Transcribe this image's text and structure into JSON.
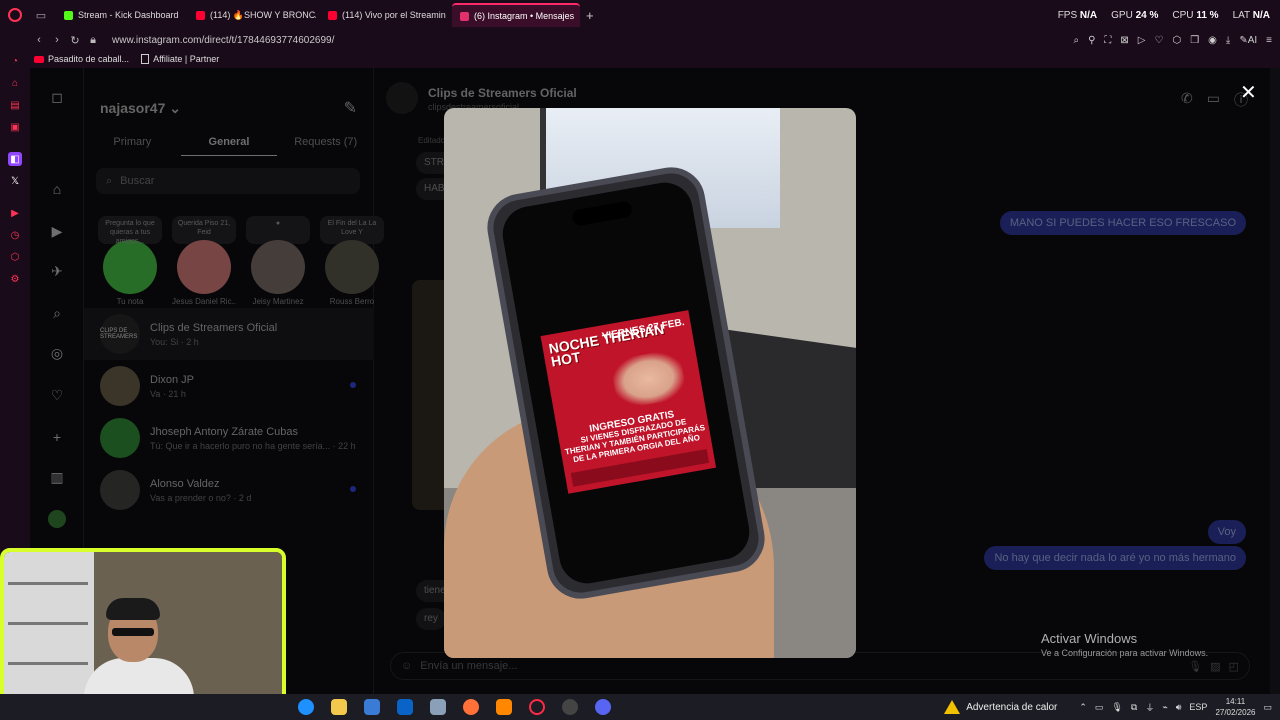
{
  "browser": {
    "tabs": [
      {
        "label": "Stream - Kick Dashboard",
        "color": "#53fc18"
      },
      {
        "label": "(114) 🔥SHOW Y BRONCA",
        "color": "#ff0033"
      },
      {
        "label": "(114) Vivo por el Streamin",
        "color": "#ff0033"
      },
      {
        "label": "(6) Instagram • Mensajes",
        "color": "#e1306c"
      }
    ],
    "url": "www.instagram.com/direct/t/17844693774602699/",
    "bookmarks": [
      "Pasadito de caball...",
      "Affiliate | Partner"
    ],
    "hud": {
      "fps_label": "FPS",
      "fps": "N/A",
      "gpu_label": "GPU",
      "gpu": "24 %",
      "cpu_label": "CPU",
      "cpu": "11 %",
      "lat_label": "LAT",
      "lat": "N/A"
    },
    "ai_label": "AI"
  },
  "instagram": {
    "username": "najasor47",
    "tabs": {
      "primary": "Primary",
      "general": "General",
      "requests": "Requests (7)"
    },
    "search_placeholder": "Buscar",
    "notes": [
      {
        "bubble": "Pregunta lo que quieras a tus amigos...",
        "name": "Tu nota"
      },
      {
        "bubble": "Querida Piso 21, Feid",
        "name": "Jesus Daniel Ric..."
      },
      {
        "bubble": "",
        "name": "Jeisy Martinez"
      },
      {
        "bubble": "El Fin del La La Love Y",
        "name": "Rouss Berro"
      }
    ],
    "threads": [
      {
        "name": "Clips de Streamers Oficial",
        "preview": "You: Si · 2 h"
      },
      {
        "name": "Dixon JP",
        "preview": "Va · 21 h"
      },
      {
        "name": "Jhoseph Antony Zárate Cubas",
        "preview": "Tú: Que ir a hacerlo puro no ha gente sería... · 22 h"
      },
      {
        "name": "Alonso Valdez",
        "preview": "Vas a prender o no? · 2 d"
      }
    ],
    "chat": {
      "name": "Clips de Streamers Oficial",
      "handle": "clipsdestreamersoficial",
      "edited_label": "Editado",
      "in_messages": [
        "STRE",
        "HABL",
        "tiene",
        "rey"
      ],
      "out_messages": [
        "MANO SI PUEDES HACER ESO FRESCASO",
        "Voy",
        "No hay que decir nada lo aré yo no más hermano"
      ],
      "input_placeholder": "Envía un mensaje..."
    }
  },
  "flyer": {
    "title": "NOCHE THERIAN HOT",
    "date": "VIERNES 27 FEB.",
    "entry": "INGRESO GRATIS",
    "promo": "SI VIENES DISFRAZADO DE THERIAN Y TAMBIÉN PARTICIPARÁS DE LA PRIMERA ORGIA DEL AÑO"
  },
  "windows": {
    "activate_title": "Activar Windows",
    "activate_sub": "Ve a Configuración para activar Windows.",
    "warning": "Advertencia de calor",
    "lang": "ESP",
    "time": "14:11",
    "date": "27/02/2026"
  }
}
